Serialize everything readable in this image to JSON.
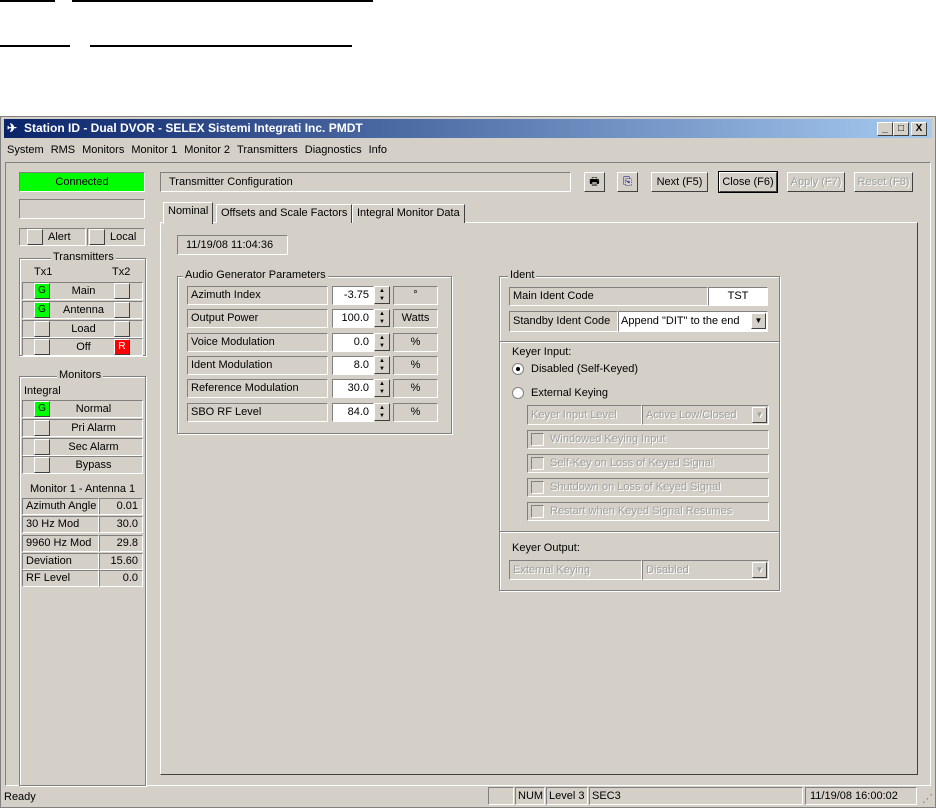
{
  "window": {
    "title": "Station ID - Dual DVOR - SELEX Sistemi Integrati Inc. PMDT",
    "controls": [
      "_",
      "□",
      "X"
    ]
  },
  "menu": [
    "System",
    "RMS",
    "Monitors",
    "Monitor 1",
    "Monitor 2",
    "Transmitters",
    "Diagnostics",
    "Info"
  ],
  "left": {
    "connection": "Connected",
    "connection_color": "#00ff00",
    "alert": "Alert",
    "local": "Local",
    "transmitters": {
      "title": "Transmitters",
      "tx1": "Tx1",
      "tx2": "Tx2",
      "rows": [
        {
          "label": "Main",
          "tx1": "G",
          "tx2": ""
        },
        {
          "label": "Antenna",
          "tx1": "G",
          "tx2": ""
        },
        {
          "label": "Load",
          "tx1": "",
          "tx2": ""
        },
        {
          "label": "Off",
          "tx1": "",
          "tx2": "R"
        }
      ]
    },
    "monitors": {
      "title": "Monitors",
      "integral": "Integral",
      "rows": [
        {
          "label": "Normal",
          "ind": "G"
        },
        {
          "label": "Pri Alarm",
          "ind": ""
        },
        {
          "label": "Sec Alarm",
          "ind": ""
        },
        {
          "label": "Bypass",
          "ind": ""
        }
      ],
      "monitor_title": "Monitor 1 - Antenna 1",
      "values": [
        {
          "label": "Azimuth Angle",
          "value": "0.01"
        },
        {
          "label": "30 Hz Mod",
          "value": "30.0"
        },
        {
          "label": "9960 Hz Mod",
          "value": "29.8"
        },
        {
          "label": "Deviation",
          "value": "15.60"
        },
        {
          "label": "RF Level",
          "value": "0.0"
        }
      ]
    }
  },
  "header": {
    "title": "Transmitter Configuration",
    "buttons": {
      "next": "Next (F5)",
      "close": "Close (F6)",
      "apply": "Apply (F7)",
      "reset": "Reset (F8)"
    }
  },
  "tabs": [
    "Nominal",
    "Offsets and Scale Factors",
    "Integral Monitor Data"
  ],
  "timestamp": "11/19/08 11:04:36",
  "audio": {
    "title": "Audio Generator Parameters",
    "rows": [
      {
        "label": "Azimuth Index",
        "value": "-3.75",
        "unit": "°"
      },
      {
        "label": "Output Power",
        "value": "100.0",
        "unit": "Watts"
      },
      {
        "label": "Voice Modulation",
        "value": "0.0",
        "unit": "%"
      },
      {
        "label": "Ident Modulation",
        "value": "8.0",
        "unit": "%"
      },
      {
        "label": "Reference Modulation",
        "value": "30.0",
        "unit": "%"
      },
      {
        "label": "SBO RF Level",
        "value": "84.0",
        "unit": "%"
      }
    ]
  },
  "ident": {
    "title": "Ident",
    "main_label": "Main Ident Code",
    "main_value": "TST",
    "standby_label": "Standby Ident Code",
    "standby_value": "Append \"DIT\" to the end",
    "keyer_input": "Keyer Input:",
    "radio_disabled": "Disabled (Self-Keyed)",
    "radio_external": "External Keying",
    "selected": "Disabled (Self-Keyed)",
    "level_label": "Keyer Input Level",
    "level_value": "Active Low/Closed",
    "checks": [
      "Windowed Keying Input",
      "Self-Key on Loss of Keyed Signal",
      "Shutdown on Loss of Keyed Signal",
      "Restart when Keyed Signal Resumes"
    ],
    "keyer_output": "Keyer Output:",
    "out_label": "External Keying",
    "out_value": "Disabled"
  },
  "status": {
    "text": "Ready",
    "num": "NUM",
    "level": "Level 3",
    "user": "SEC3",
    "datetime": "11/19/08 16:00:02"
  }
}
